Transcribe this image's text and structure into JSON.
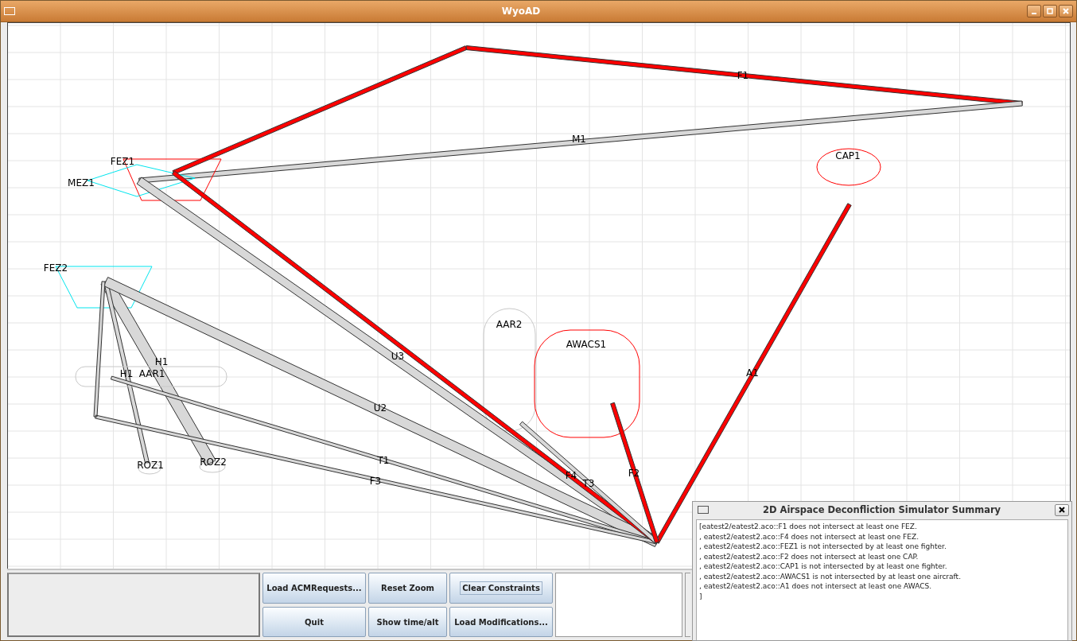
{
  "window": {
    "title": "WyoAD"
  },
  "map": {
    "airspaces": [
      {
        "label": "F1",
        "kind": "route"
      },
      {
        "label": "M1",
        "kind": "corridor"
      },
      {
        "label": "CAP1",
        "kind": "ellipse",
        "color": "#ff0000"
      },
      {
        "label": "FEZ1",
        "kind": "polygon",
        "color": "#ff0000"
      },
      {
        "label": "MEZ1",
        "kind": "polygon",
        "color": "#00e5ee"
      },
      {
        "label": "FEZ2",
        "kind": "polygon",
        "color": "#00e5ee"
      },
      {
        "label": "AAR2",
        "kind": "racetrack",
        "color": "#c8c8c8"
      },
      {
        "label": "AWACS1",
        "kind": "racetrack",
        "color": "#ff0000"
      },
      {
        "label": "U3",
        "kind": "corridor"
      },
      {
        "label": "H1",
        "kind": "corridor"
      },
      {
        "label": "H1",
        "kind": "corridor"
      },
      {
        "label": "AAR1",
        "kind": "racetrack",
        "color": "#c8c8c8"
      },
      {
        "label": "A1",
        "kind": "route"
      },
      {
        "label": "U2",
        "kind": "corridor"
      },
      {
        "label": "ROZ1",
        "kind": "ellipse",
        "color": "#c8c8c8"
      },
      {
        "label": "ROZ2",
        "kind": "ellipse",
        "color": "#c8c8c8"
      },
      {
        "label": "T1",
        "kind": "corridor"
      },
      {
        "label": "F3",
        "kind": "corridor"
      },
      {
        "label": "F4",
        "kind": "route"
      },
      {
        "label": "T3",
        "kind": "corridor"
      },
      {
        "label": "F2",
        "kind": "route"
      }
    ]
  },
  "buttons": [
    {
      "label": "Load ACMRequests...",
      "focused": false
    },
    {
      "label": "Reset Zoom",
      "focused": false
    },
    {
      "label": "Clear Constraints",
      "focused": true
    },
    {
      "label": "Quit",
      "focused": false
    },
    {
      "label": "Show time/alt",
      "focused": false
    },
    {
      "label": "Load Modifications...",
      "focused": false
    }
  ],
  "summary": {
    "title": "2D Airspace Deconfliction Simulator Summary",
    "lines": [
      "[eatest2/eatest2.aco::F1 does not intersect at least one FEZ.",
      ", eatest2/eatest2.aco::F4 does not intersect at least one FEZ.",
      ", eatest2/eatest2.aco::FEZ1 is not intersected by at least one fighter.",
      ", eatest2/eatest2.aco::F2 does not intersect at least one CAP.",
      ", eatest2/eatest2.aco::CAP1 is not intersected by at least one fighter.",
      ", eatest2/eatest2.aco::AWACS1 is not intersected by at least one aircraft.",
      ", eatest2/eatest2.aco::A1 does not intersect at least one AWACS.",
      "]"
    ]
  }
}
